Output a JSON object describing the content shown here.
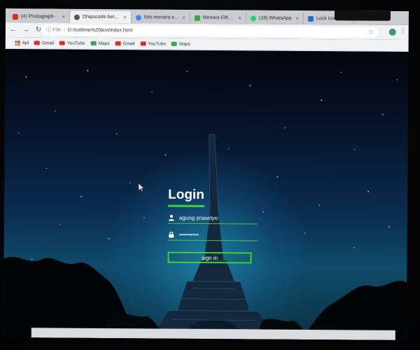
{
  "browser": {
    "tabs": [
      {
        "title": "(4) Photograph -",
        "favicon_color": "#e02b20",
        "icon": "youtube-icon",
        "active": false
      },
      {
        "title": "Dhipacode-belajar lan",
        "favicon_color": "#555555",
        "icon": "globe-icon",
        "active": true
      },
      {
        "title": "foto menara eiffel - P",
        "favicon_color": "#4285f4",
        "icon": "google-icon",
        "active": false
      },
      {
        "title": "Menara Eiffel Monum",
        "favicon_color": "#3aa84a",
        "icon": "site-icon",
        "active": false
      },
      {
        "title": "(18) WhatsApp",
        "favicon_color": "#25d366",
        "icon": "whatsapp-icon",
        "active": false
      },
      {
        "title": "Lock Icon | Font A",
        "favicon_color": "#1e72c9",
        "icon": "fontawesome-icon",
        "active": false
      }
    ],
    "address": {
      "scheme": "File",
      "url": "D:/sublime%20text/index.html"
    },
    "bookmarks": [
      {
        "label": "Apl",
        "icon": "apps-icon",
        "color": "#d24a3a"
      },
      {
        "label": "Gmail",
        "icon": "gmail-icon",
        "color": "#d93025"
      },
      {
        "label": "YouTube",
        "icon": "youtube-icon",
        "color": "#e02b20"
      },
      {
        "label": "Maps",
        "icon": "maps-icon",
        "color": "#34a853"
      },
      {
        "label": "Gmail",
        "icon": "gmail-icon",
        "color": "#d93025"
      },
      {
        "label": "YouTube",
        "icon": "youtube-icon",
        "color": "#e02b20"
      },
      {
        "label": "Maps",
        "icon": "maps-icon",
        "color": "#34a853"
      }
    ]
  },
  "login": {
    "title": "Login",
    "username_value": "agung prasetyo",
    "password_value": "••••••••••",
    "signin_label": "sign in",
    "accent_color": "#3fcf3a"
  }
}
